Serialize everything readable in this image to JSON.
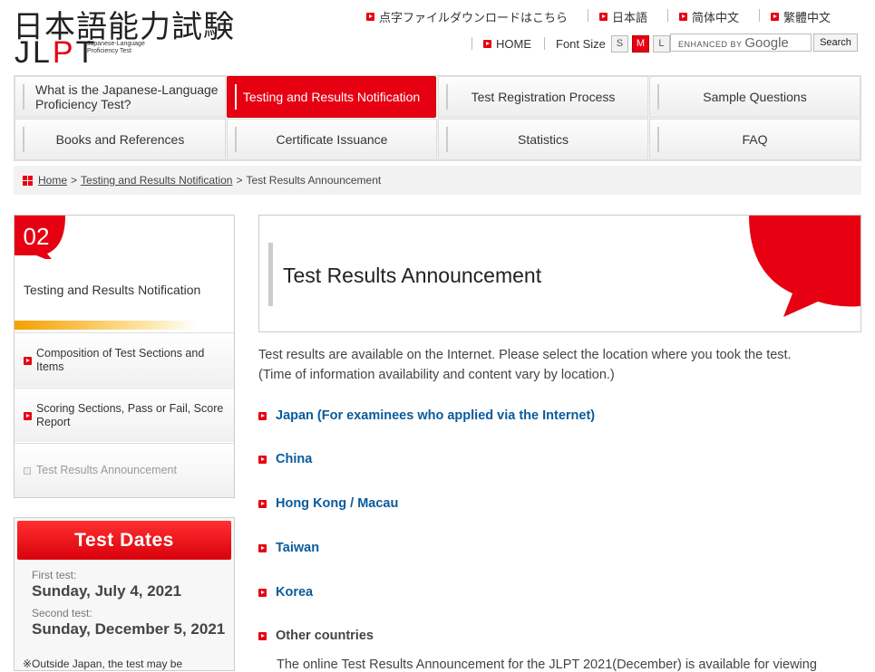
{
  "header": {
    "logo_kanji": "日本語能力試験",
    "logo_jlpt_left": "JL",
    "logo_jlpt_dot": "P",
    "logo_jlpt_right": "T",
    "logo_sub": "Japanese-Language Proficiency Test",
    "top_links": [
      "点字ファイルダウンロードはこちら",
      "日本語",
      "简体中文",
      "繁體中文"
    ],
    "home_label": "HOME",
    "font_size_label": "Font Size",
    "font_sizes": [
      "S",
      "M",
      "L"
    ],
    "search_enhanced": "ENHANCED BY",
    "search_google": "Google",
    "search_button": "Search"
  },
  "nav": [
    "What is the Japanese-Language Proficiency Test?",
    "Testing and Results Notification",
    "Test Registration Process",
    "Sample Questions",
    "Books and References",
    "Certificate Issuance",
    "Statistics",
    "FAQ"
  ],
  "breadcrumb": [
    "Home",
    "Testing and Results Notification",
    "Test Results Announcement"
  ],
  "sidebar": {
    "number": "02",
    "title": "Testing and Results Notification",
    "items": [
      "Composition of Test Sections and Items",
      "Scoring Sections, Pass or Fail, Score Report",
      "Test Results Announcement"
    ]
  },
  "test_dates": {
    "heading": "Test Dates",
    "first_label": "First test:",
    "first_date": "Sunday, July 4, 2021",
    "second_label": "Second test:",
    "second_date": "Sunday, December 5, 2021",
    "note": "※Outside Japan, the test may be"
  },
  "main": {
    "title": "Test Results Announcement",
    "intro_1": "Test results are available on the Internet. Please select the location where you took the test.",
    "intro_2": "(Time of information availability and content vary by location.)",
    "locations": [
      "Japan (For examinees who applied via the Internet)",
      "China",
      "Hong Kong / Macau",
      "Taiwan",
      "Korea"
    ],
    "other_label": "Other countries",
    "other_note": "The online Test Results Announcement for the JLPT 2021(December) is available for viewing"
  },
  "colors": {
    "accent": "#e60012",
    "link": "#0a5b9c"
  }
}
